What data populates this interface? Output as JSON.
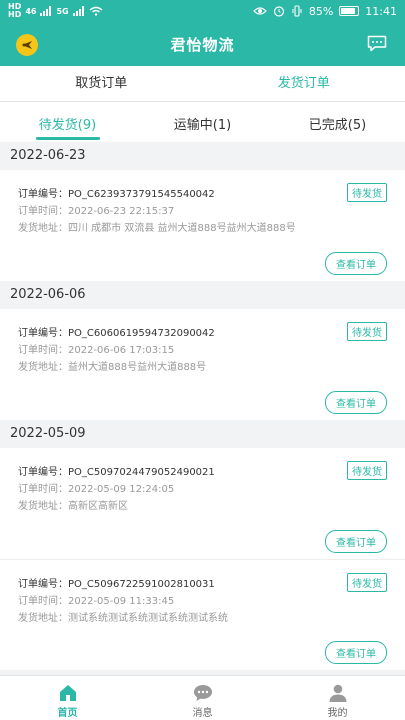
{
  "status_bar": {
    "time": "11:41",
    "battery": "85%",
    "net1": "HD",
    "net2": "46",
    "net3": "5G"
  },
  "app_bar": {
    "title": "君怡物流"
  },
  "top_tabs": [
    {
      "label": "取货订单",
      "active": false
    },
    {
      "label": "发货订单",
      "active": true
    }
  ],
  "sub_tabs": [
    {
      "label": "待发货(9)",
      "active": true
    },
    {
      "label": "运输中(1)",
      "active": false
    },
    {
      "label": "已完成(5)",
      "active": false
    }
  ],
  "labels": {
    "order_no": "订单编号：",
    "order_time": "订单时间：",
    "ship_addr": "发货地址：",
    "view_button": "查看订单"
  },
  "groups": [
    {
      "date": "2022-06-23",
      "orders": [
        {
          "order_no": "PO_C6239373791545540042",
          "time": "2022-06-23 22:15:37",
          "address": "四川 成都市 双流县 益州大道888号益州大道888号",
          "status": "待发货"
        }
      ]
    },
    {
      "date": "2022-06-06",
      "orders": [
        {
          "order_no": "PO_C6060619594732090042",
          "time": "2022-06-06 17:03:15",
          "address": "益州大道888号益州大道888号",
          "status": "待发货"
        }
      ]
    },
    {
      "date": "2022-05-09",
      "orders": [
        {
          "order_no": "PO_C5097024479052490021",
          "time": "2022-05-09 12:24:05",
          "address": "高新区高新区",
          "status": "待发货"
        },
        {
          "order_no": "PO_C5096722591002810031",
          "time": "2022-05-09 11:33:45",
          "address": "测试系统测试系统测试系统测试系统",
          "status": "待发货"
        }
      ]
    }
  ],
  "bottom_nav": [
    {
      "label": "首页",
      "icon": "home-icon",
      "active": true
    },
    {
      "label": "消息",
      "icon": "chat-icon",
      "active": false
    },
    {
      "label": "我的",
      "icon": "user-icon",
      "active": false
    }
  ],
  "colors": {
    "accent": "#2bb8a6",
    "logo": "#f5c518"
  }
}
